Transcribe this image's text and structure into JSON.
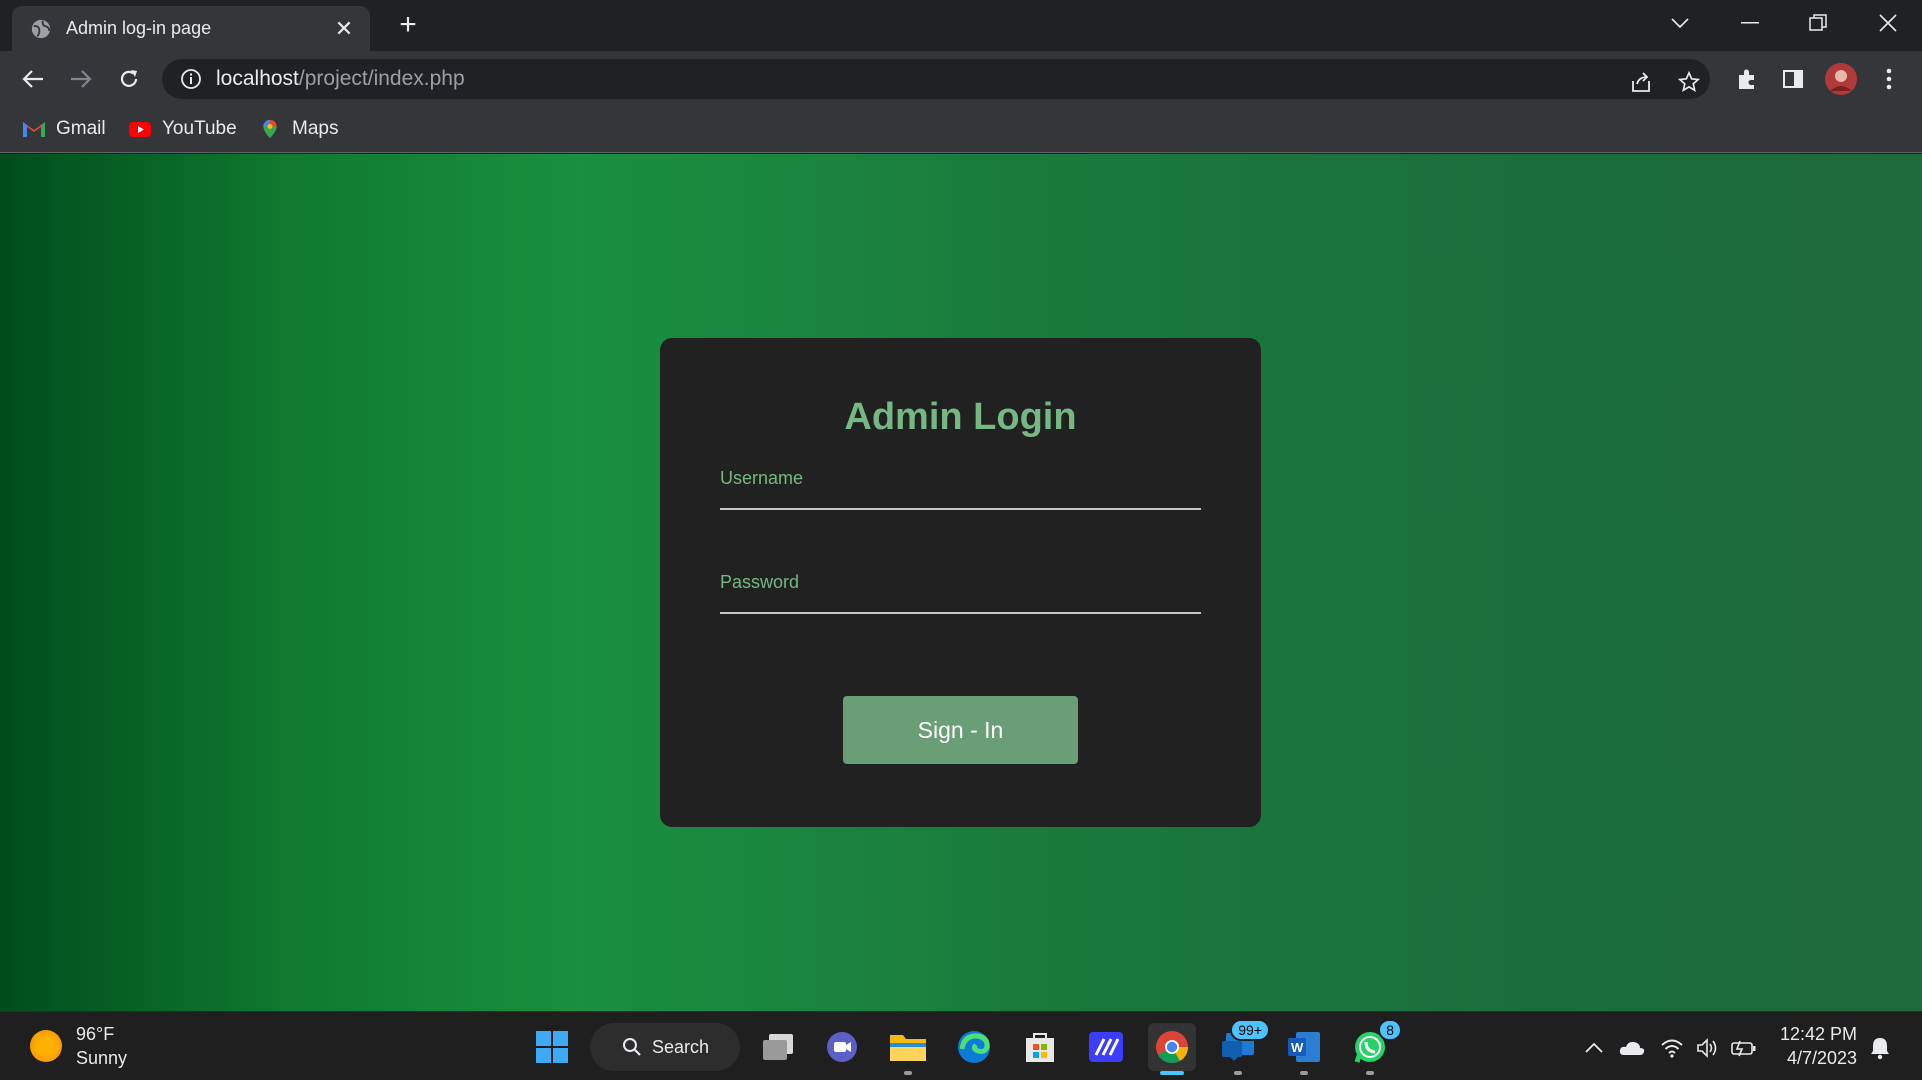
{
  "browser": {
    "tab_title": "Admin log-in page",
    "url_host": "localhost",
    "url_path": "/project/index.php",
    "bookmarks": [
      {
        "label": "Gmail",
        "icon": "gmail-icon"
      },
      {
        "label": "YouTube",
        "icon": "youtube-icon"
      },
      {
        "label": "Maps",
        "icon": "maps-icon"
      }
    ]
  },
  "login": {
    "title": "Admin Login",
    "username_label": "Username",
    "username_value": "",
    "password_label": "Password",
    "password_value": "",
    "submit_label": "Sign - In"
  },
  "taskbar": {
    "weather_temp": "96°F",
    "weather_desc": "Sunny",
    "search_label": "Search",
    "mail_badge": "99+",
    "whatsapp_badge": "8",
    "time": "12:42 PM",
    "date": "4/7/2023"
  },
  "colors": {
    "accent_green": "#75b883",
    "button_green": "#6a9e76",
    "card_bg": "#212121"
  }
}
